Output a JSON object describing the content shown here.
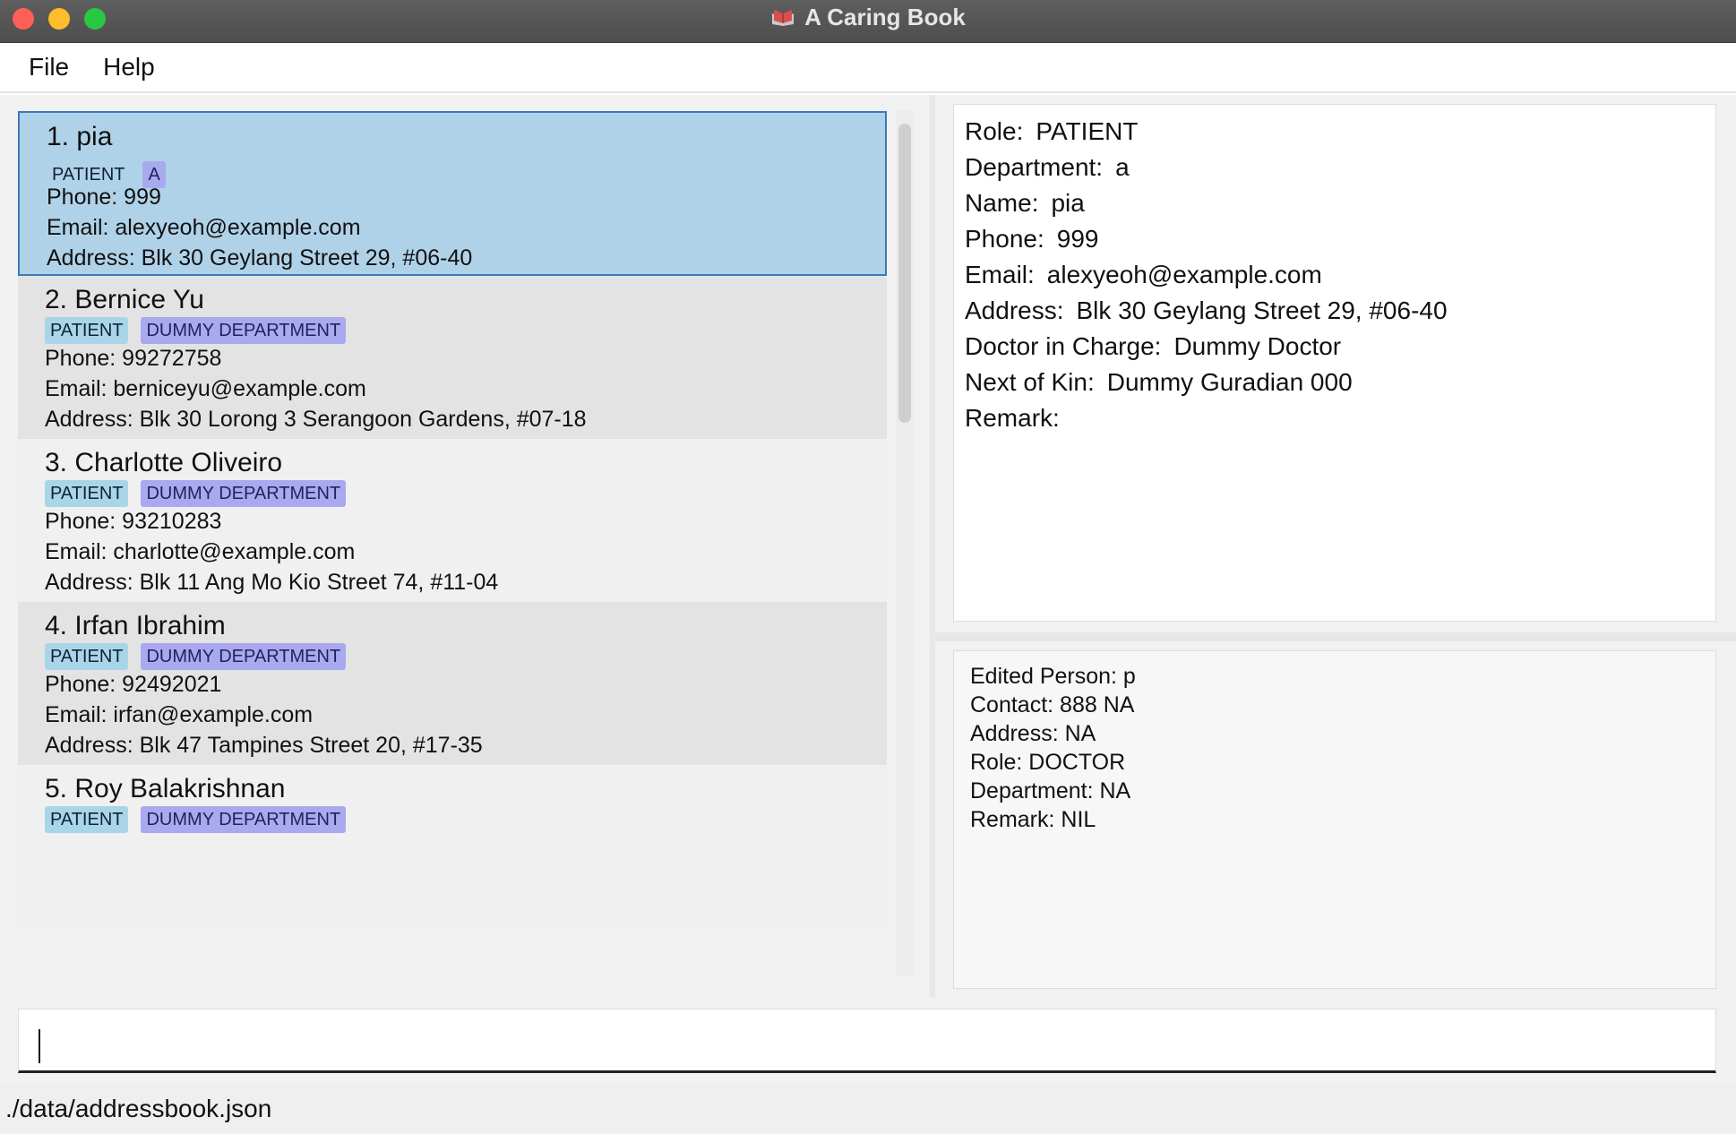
{
  "window": {
    "title": "A Caring Book",
    "app_icon": "book-icon"
  },
  "menu": {
    "items": [
      "File",
      "Help"
    ]
  },
  "persons": [
    {
      "name": "1. pia",
      "role_tag": "PATIENT",
      "dept_tag": "A",
      "phone": "Phone: 999",
      "email": "Email: alexyeoh@example.com",
      "address": "Address: Blk 30 Geylang Street 29, #06-40"
    },
    {
      "name": "2. Bernice Yu",
      "role_tag": "PATIENT",
      "dept_tag": "DUMMY DEPARTMENT",
      "phone": "Phone: 99272758",
      "email": "Email: berniceyu@example.com",
      "address": "Address: Blk 30 Lorong 3 Serangoon Gardens, #07-18"
    },
    {
      "name": "3. Charlotte Oliveiro",
      "role_tag": "PATIENT",
      "dept_tag": "DUMMY DEPARTMENT",
      "phone": "Phone: 93210283",
      "email": "Email: charlotte@example.com",
      "address": "Address: Blk 11 Ang Mo Kio Street 74, #11-04"
    },
    {
      "name": "4. Irfan Ibrahim",
      "role_tag": "PATIENT",
      "dept_tag": "DUMMY DEPARTMENT",
      "phone": "Phone: 92492021",
      "email": "Email: irfan@example.com",
      "address": "Address: Blk 47 Tampines Street 20, #17-35"
    },
    {
      "name": "5. Roy Balakrishnan",
      "role_tag": "PATIENT",
      "dept_tag": "DUMMY DEPARTMENT"
    }
  ],
  "selected_index": 0,
  "detail": {
    "role_label": "Role:",
    "role_value": "PATIENT",
    "department_label": "Department:",
    "department_value": "a",
    "name_label": "Name:",
    "name_value": "pia",
    "phone_label": "Phone:",
    "phone_value": "999",
    "email_label": "Email:",
    "email_value": "alexyeoh@example.com",
    "address_label": "Address:",
    "address_value": "Blk 30 Geylang Street 29, #06-40",
    "doctor_label": "Doctor in Charge:",
    "doctor_value": "Dummy Doctor",
    "kin_label": "Next of Kin:",
    "kin_value": "Dummy Guradian 000",
    "remark_label": "Remark:",
    "remark_value": ""
  },
  "result": {
    "lines": [
      "Edited Person: p",
      "Contact: 888 NA",
      "Address: NA",
      "Role: DOCTOR",
      "Department: NA",
      "Remark: NIL"
    ]
  },
  "command": {
    "value": "",
    "placeholder": ""
  },
  "status_bar": {
    "path": "./data/addressbook.json"
  },
  "colors": {
    "selected_card": "#b0d2e8",
    "role_tag": "#a8d6e8",
    "dept_tag": "#a9a9f0",
    "close": "#ff5f57",
    "minimize": "#febc2e",
    "maximize": "#28c840"
  }
}
